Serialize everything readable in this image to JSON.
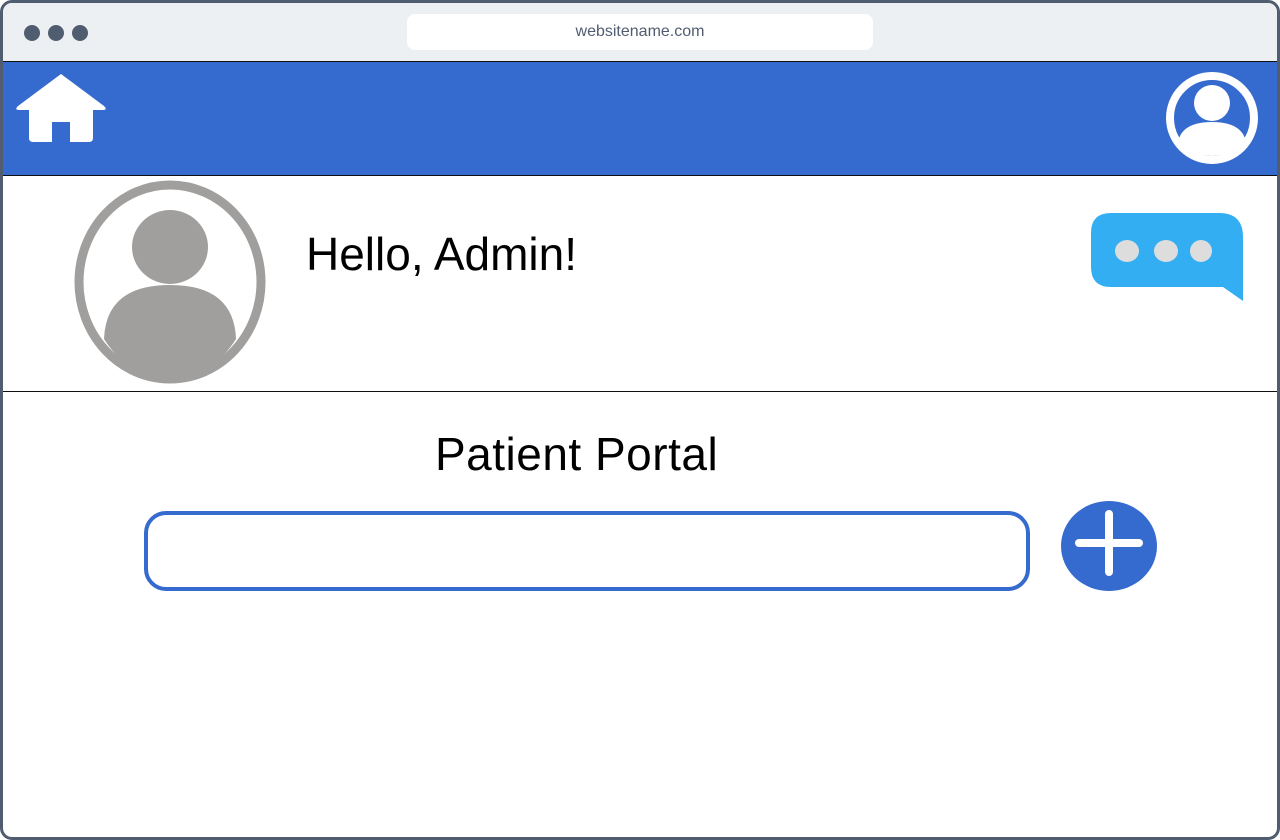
{
  "browser": {
    "url": "websitename.com"
  },
  "navbar": {
    "home_icon": "home-icon",
    "account_icon": "user-account-icon",
    "color": "#356acf"
  },
  "profile": {
    "avatar_icon": "user-avatar-icon",
    "greeting": "Hello, Admin!",
    "chat_icon": "chat-bubble-icon"
  },
  "portal": {
    "title": "Patient Portal",
    "search_value": "",
    "search_placeholder": "",
    "add_icon": "plus-icon"
  },
  "colors": {
    "accent": "#356acf",
    "chat": "#34aef2",
    "avatar_gray": "#a19f9d",
    "frame": "#505d70",
    "titlebar": "#edf0f2"
  }
}
